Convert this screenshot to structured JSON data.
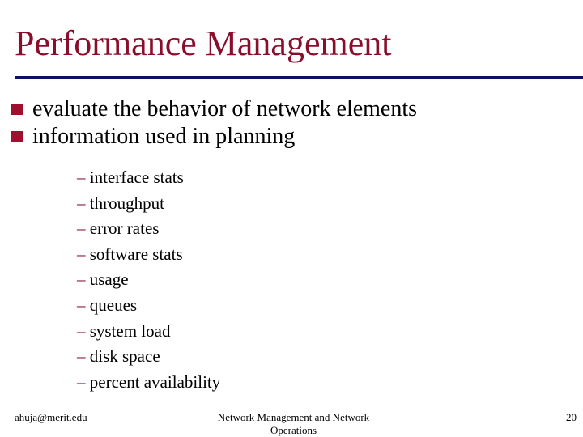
{
  "slide": {
    "title": "Performance Management",
    "bullets": [
      "evaluate the behavior of network elements",
      "information used in planning"
    ],
    "sub_bullet_marker": "–",
    "sub_bullets": [
      "interface stats",
      "throughput",
      "error rates",
      "software stats",
      "usage",
      "queues",
      "system load",
      "disk space",
      "percent availability"
    ],
    "colors": {
      "title": "#8b0d2c",
      "rule": "#0a1260",
      "bullet_square": "#a0102e"
    }
  },
  "footer": {
    "left": "ahuja@merit.edu",
    "center": "Network Management and Network Operations",
    "page_number": "20"
  }
}
